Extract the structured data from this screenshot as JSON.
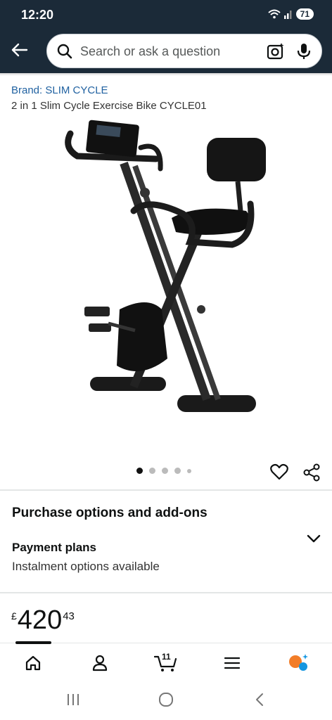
{
  "status_bar": {
    "time": "12:20",
    "battery": "71"
  },
  "search": {
    "placeholder": "Search or ask a question"
  },
  "product": {
    "brand": "Brand: SLIM CYCLE",
    "title": "2 in 1 Slim Cycle Exercise Bike CYCLE01",
    "image_count": 5,
    "active_image": 1
  },
  "purchase": {
    "heading": "Purchase options and add-ons",
    "payment_title": "Payment plans",
    "payment_sub": "Instalment options available"
  },
  "price": {
    "symbol": "£",
    "whole": "420",
    "fraction": "43"
  },
  "bottom_nav": {
    "cart_count": "11"
  },
  "colors": {
    "header": "#1b2a38",
    "link": "#2162a1",
    "assistant_orange": "#f27d28",
    "assistant_blue": "#1596e0"
  }
}
